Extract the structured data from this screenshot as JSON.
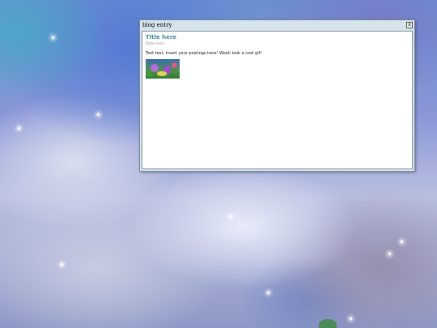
{
  "window": {
    "title": "blog entry",
    "close_label": "x"
  },
  "post": {
    "title": "Title here",
    "date": "Date here",
    "body": "Text text, insert your postings here! Woah look a cool gif!",
    "image_name": "cool-gif"
  },
  "colors": {
    "title_bar": "#d4e3ec",
    "post_title": "#4a8a9e",
    "date_text": "#8a8a8a"
  }
}
